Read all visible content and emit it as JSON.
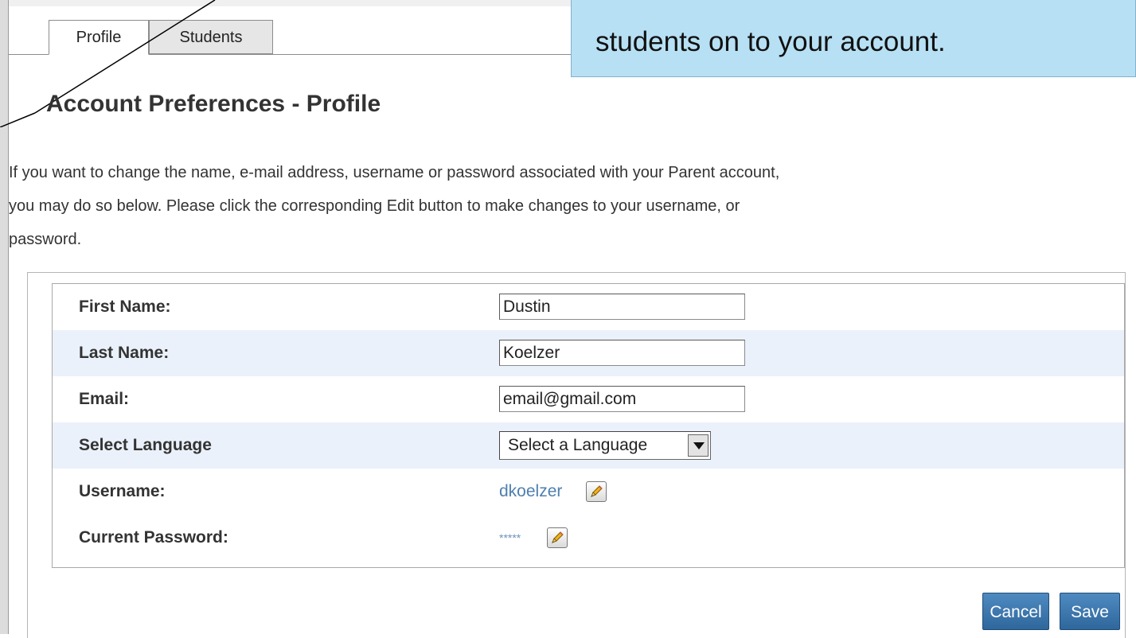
{
  "tabs": [
    {
      "label": "Profile",
      "active": true
    },
    {
      "label": "Students",
      "active": false
    }
  ],
  "callout": {
    "text": "students on to your account."
  },
  "page": {
    "title": "Account Preferences - Profile",
    "intro_lines": [
      "If you want to change the name, e-mail address, username or password associated with your Parent account,",
      "you may do so below. Please click the corresponding Edit button to make changes to your username, or",
      "password."
    ]
  },
  "form": {
    "first_name": {
      "label": "First Name:",
      "value": "Dustin"
    },
    "last_name": {
      "label": "Last Name:",
      "value": "Koelzer"
    },
    "email": {
      "label": "Email:",
      "value": "email@gmail.com"
    },
    "language": {
      "label": "Select Language",
      "value": "Select a Language"
    },
    "username": {
      "label": "Username:",
      "value": "dkoelzer",
      "edit_icon": "pencil-icon"
    },
    "password": {
      "label": "Current Password:",
      "value": "*****",
      "edit_icon": "pencil-icon"
    }
  },
  "buttons": {
    "cancel": "Cancel",
    "save": "Save"
  },
  "colors": {
    "callout_bg": "#b7e0f4",
    "row_shade": "#eaf1fb",
    "link": "#4d7fb0",
    "button": "#3a75ad"
  }
}
